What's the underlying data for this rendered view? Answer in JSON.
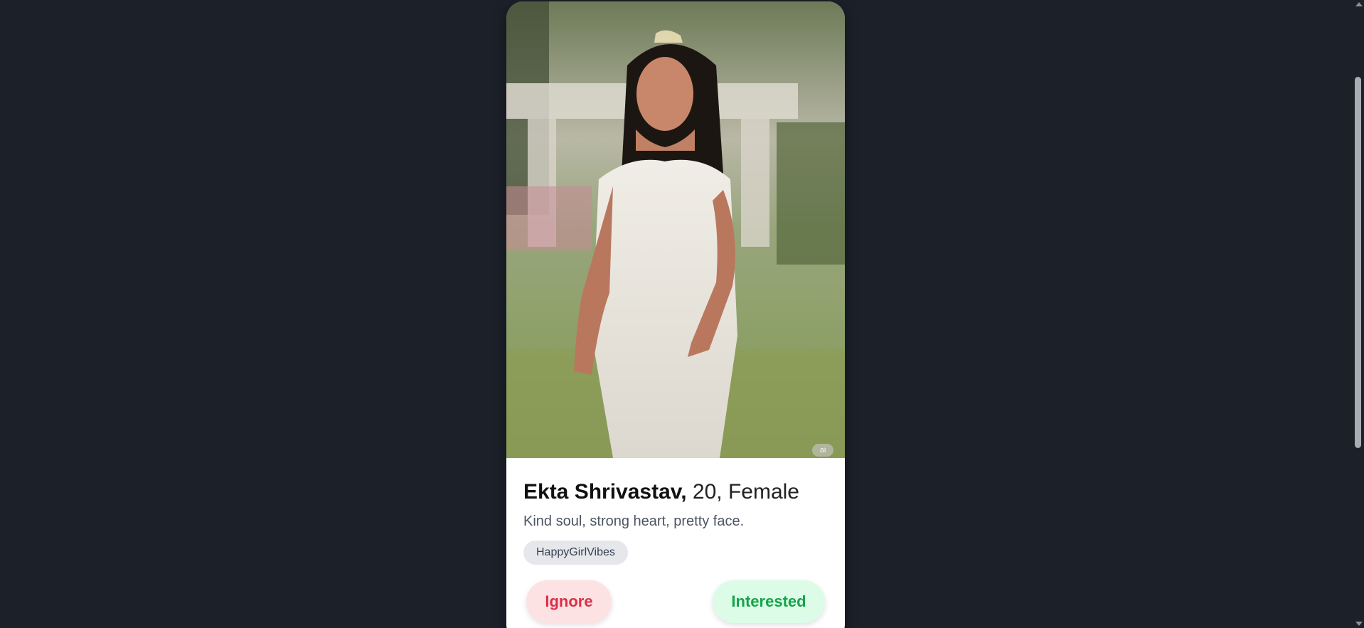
{
  "profile": {
    "name": "Ekta Shrivastav,",
    "meta": "20, Female",
    "bio": "Kind soul, strong heart, pretty face.",
    "tags": [
      "HappyGirlVibes"
    ],
    "ai_badge": "ai"
  },
  "actions": {
    "ignore_label": "Ignore",
    "interested_label": "Interested"
  },
  "colors": {
    "background": "#1b2029",
    "ignore_text": "#dc2f45",
    "ignore_bg": "#fde2e4",
    "interested_text": "#16a34a",
    "interested_bg": "#dcfce7"
  }
}
